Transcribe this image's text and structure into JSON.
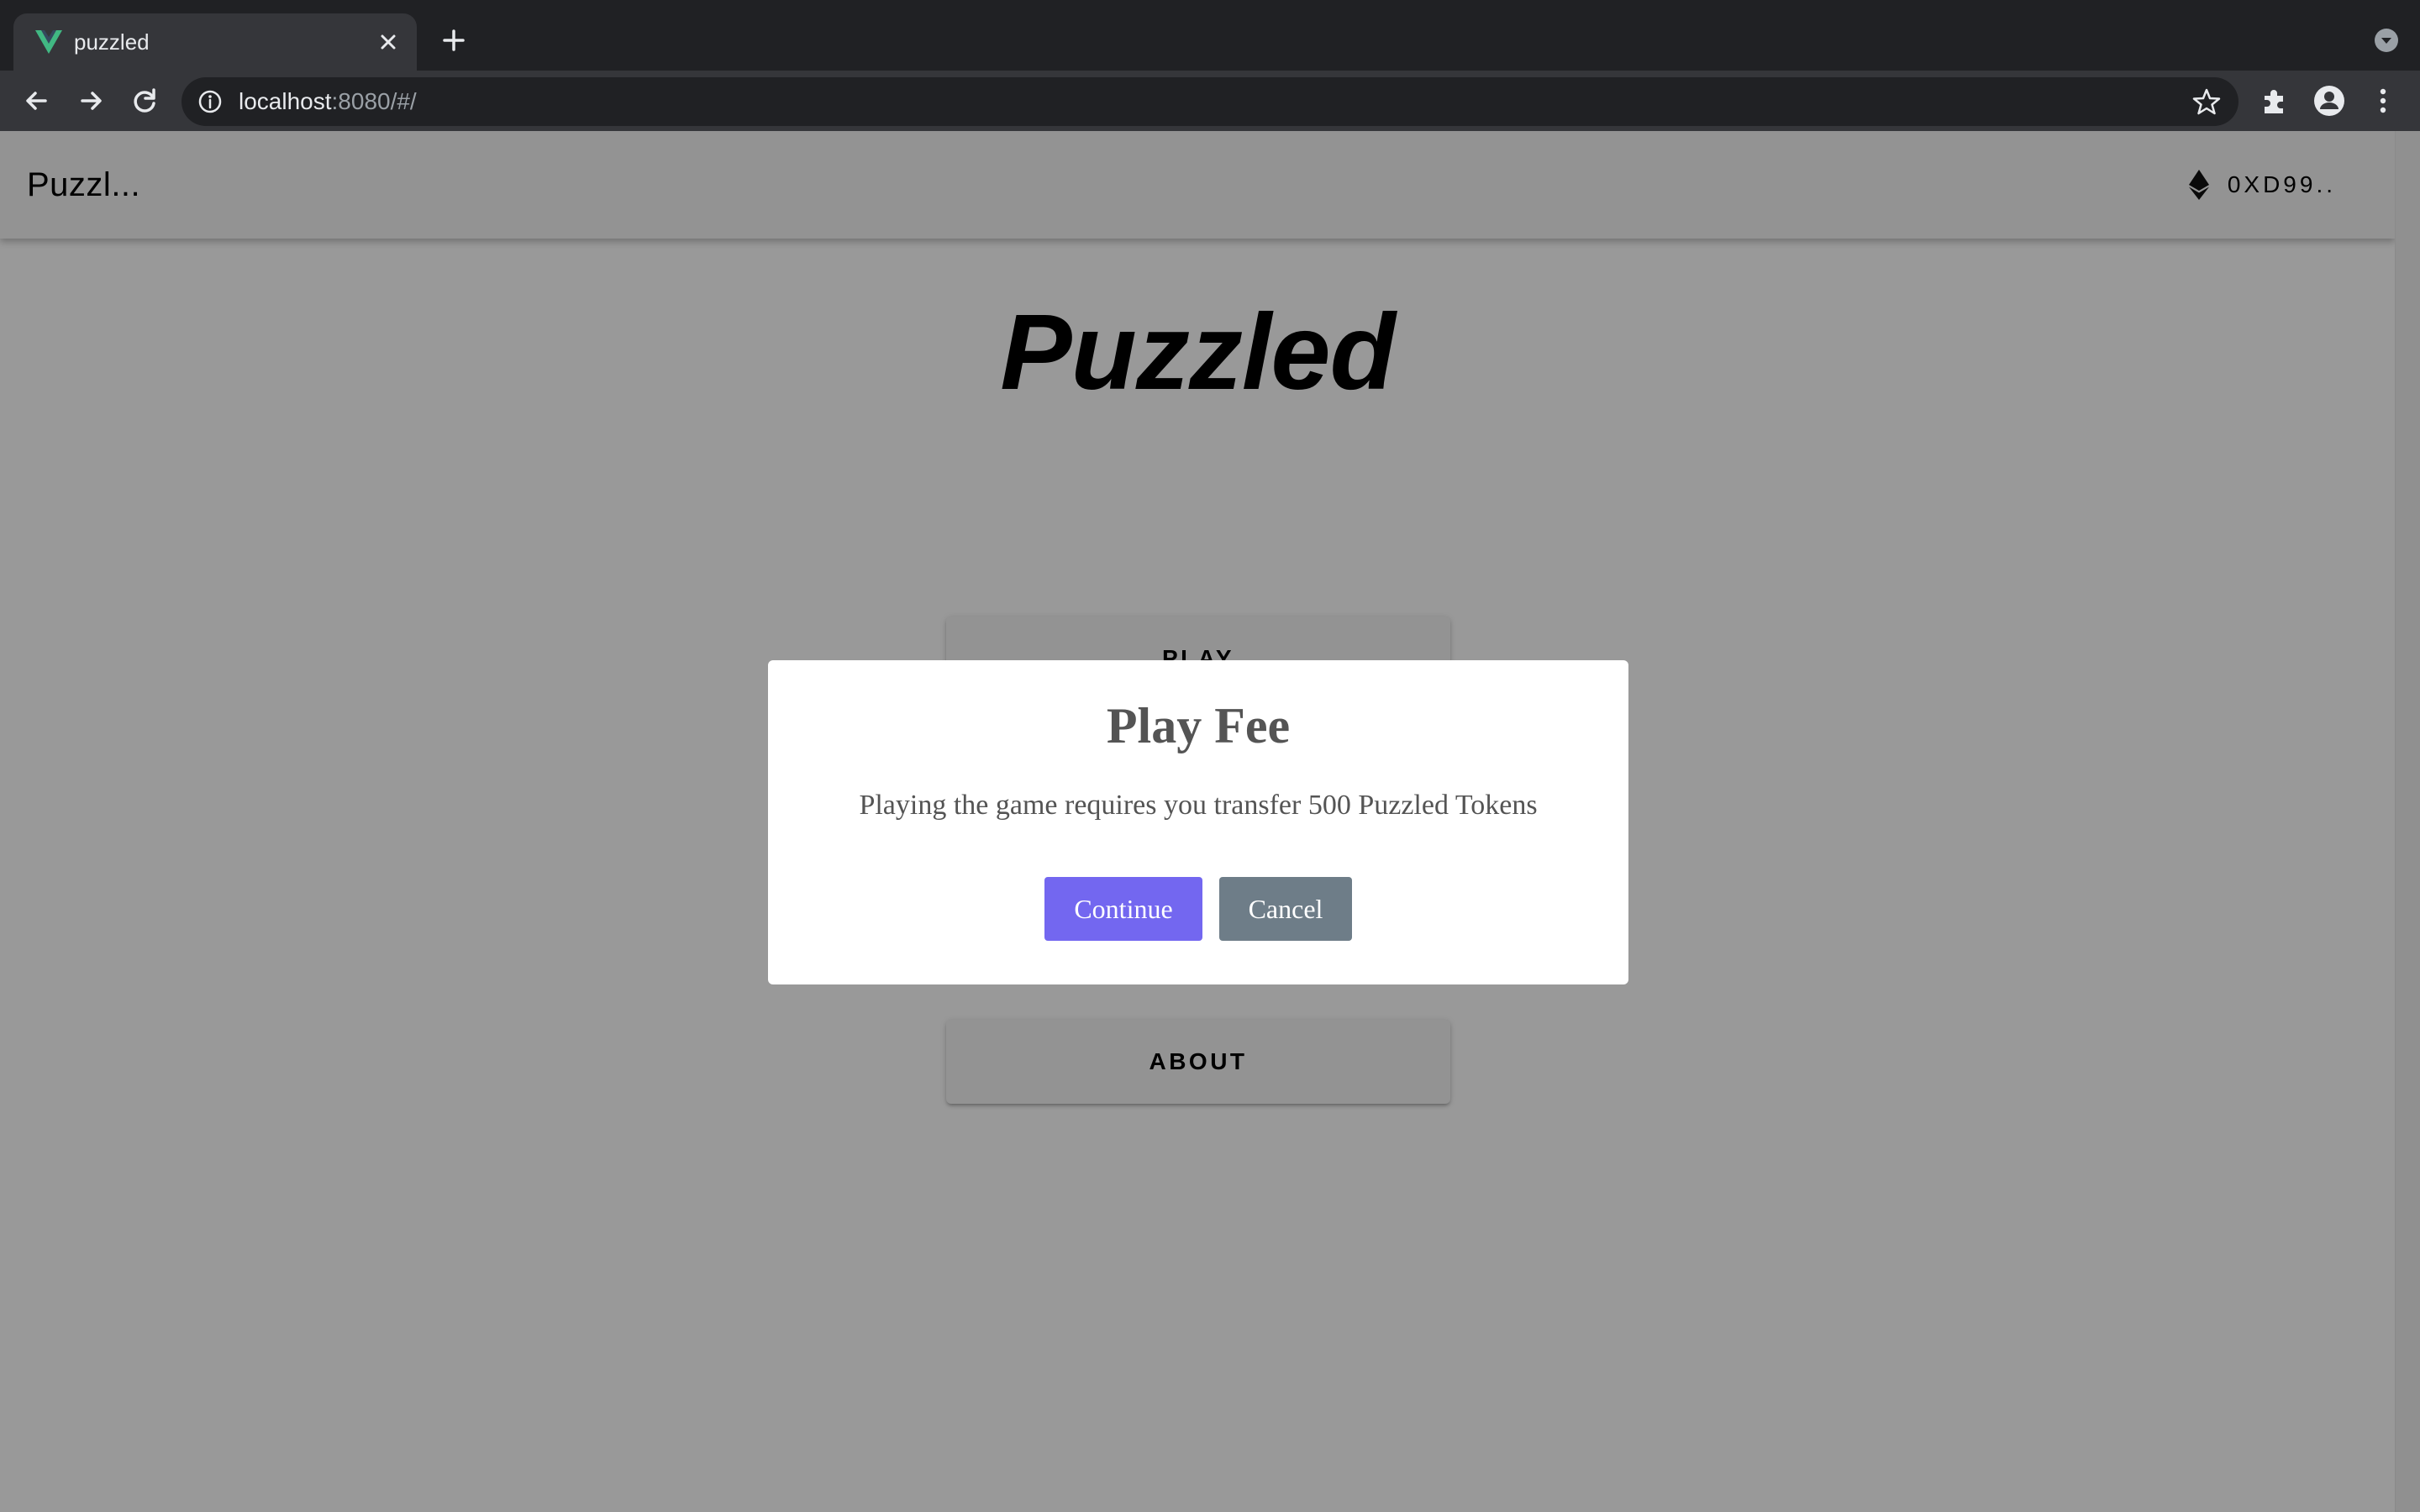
{
  "browser": {
    "tab": {
      "title": "puzzled",
      "favicon": "vue-logo-icon"
    },
    "url": {
      "host": "localhost",
      "rest": ":8080/#/"
    },
    "icons": [
      "back-arrow-icon",
      "forward-arrow-icon",
      "reload-icon",
      "info-icon",
      "star-icon",
      "extensions-icon",
      "profile-icon",
      "kebab-menu-icon",
      "tab-search-icon",
      "new-tab-icon",
      "close-icon"
    ]
  },
  "app_bar": {
    "title": "Puzzl...",
    "wallet": {
      "icon": "ethereum-icon",
      "address": "0XD99.."
    }
  },
  "page": {
    "title": "Puzzled",
    "buttons": {
      "play": "PLAY",
      "about": "ABOUT"
    }
  },
  "modal": {
    "title": "Play Fee",
    "text": "Playing the game requires you transfer 500 Puzzled Tokens",
    "continue_label": "Continue",
    "cancel_label": "Cancel",
    "colors": {
      "continue": "#7367f0",
      "cancel": "#6e7d88"
    }
  }
}
